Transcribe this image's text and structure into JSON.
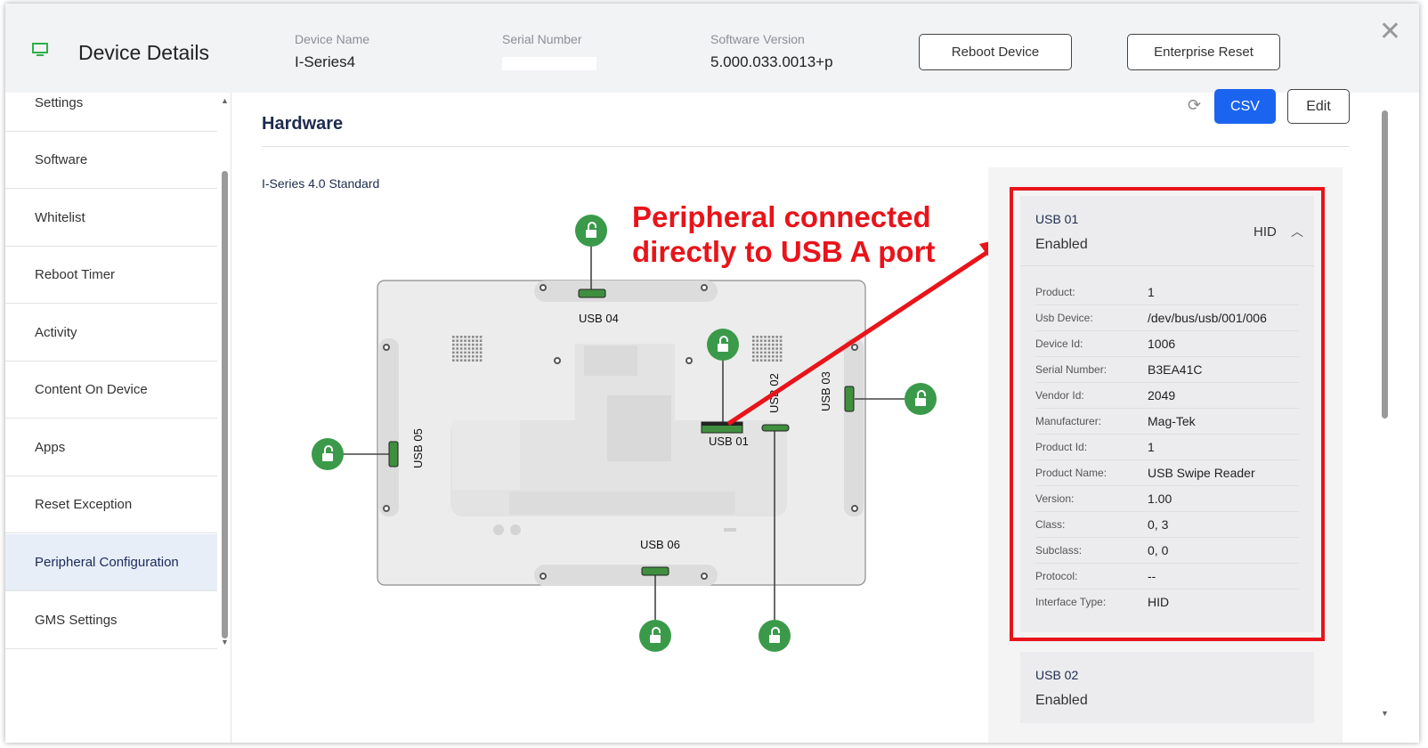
{
  "header": {
    "title": "Device Details",
    "device_name_label": "Device Name",
    "device_name": "I-Series4",
    "serial_label": "Serial Number",
    "software_label": "Software Version",
    "software_version": "5.000.033.0013+p",
    "reboot_label": "Reboot Device",
    "reset_label": "Enterprise Reset",
    "icon": "monitor-icon",
    "icon_color": "#2db04b"
  },
  "sidebar": {
    "items": [
      {
        "label": "Settings"
      },
      {
        "label": "Software"
      },
      {
        "label": "Whitelist"
      },
      {
        "label": "Reboot Timer"
      },
      {
        "label": "Activity"
      },
      {
        "label": "Content On Device"
      },
      {
        "label": "Apps"
      },
      {
        "label": "Reset Exception"
      },
      {
        "label": "Peripheral Configuration",
        "active": true
      },
      {
        "label": "GMS Settings"
      }
    ]
  },
  "main": {
    "title": "Hardware",
    "model": "I-Series 4.0 Standard",
    "csv_label": "CSV",
    "edit_label": "Edit",
    "accent": "#1b64f0"
  },
  "diagram": {
    "ports": [
      "USB 01",
      "USB 02",
      "USB 03",
      "USB 04",
      "USB 05",
      "USB 06"
    ],
    "lock_color": "#3a9a4a"
  },
  "annotation": {
    "line1": "Peripheral connected",
    "line2": "directly to USB A port",
    "color": "#e8141a"
  },
  "usb01": {
    "id": "USB 01",
    "status": "Enabled",
    "type": "HID",
    "props": [
      {
        "k": "Product:",
        "v": "1"
      },
      {
        "k": "Usb Device:",
        "v": "/dev/bus/usb/001/006"
      },
      {
        "k": "Device Id:",
        "v": "1006"
      },
      {
        "k": "Serial Number:",
        "v": "B3EA41C"
      },
      {
        "k": "Vendor Id:",
        "v": "2049"
      },
      {
        "k": "Manufacturer:",
        "v": "Mag-Tek"
      },
      {
        "k": "Product Id:",
        "v": "1"
      },
      {
        "k": "Product Name:",
        "v": "USB Swipe Reader"
      },
      {
        "k": "Version:",
        "v": "1.00"
      },
      {
        "k": "Class:",
        "v": "0, 3"
      },
      {
        "k": "Subclass:",
        "v": "0, 0"
      },
      {
        "k": "Protocol:",
        "v": "--"
      },
      {
        "k": "Interface Type:",
        "v": "HID"
      }
    ]
  },
  "usb02": {
    "id": "USB 02",
    "status": "Enabled"
  }
}
